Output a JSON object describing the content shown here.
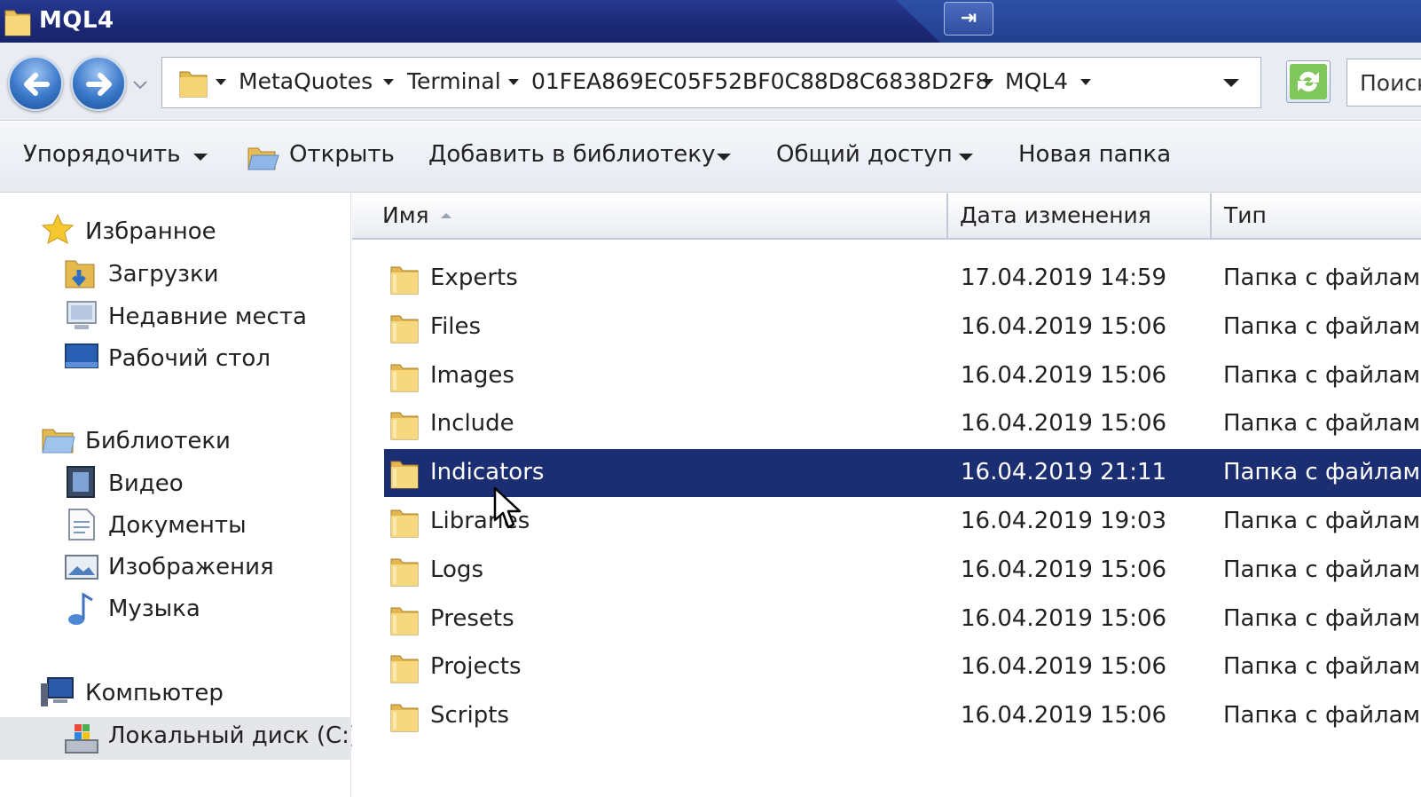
{
  "window": {
    "title": "MQL4"
  },
  "address": {
    "crumbs": [
      "MetaQuotes",
      "Terminal",
      "01FEA869EC05F52BF0C88D8C6838D2F8",
      "MQL4"
    ],
    "search_placeholder": "Поиск"
  },
  "toolbar": {
    "organize": "Упорядочить",
    "open": "Открыть",
    "add_library": "Добавить в библиотеку",
    "share": "Общий доступ",
    "new_folder": "Новая папка"
  },
  "nav": {
    "favorites": "Избранное",
    "downloads": "Загрузки",
    "recent": "Недавние места",
    "desktop": "Рабочий стол",
    "libraries": "Библиотеки",
    "video": "Видео",
    "documents": "Документы",
    "images": "Изображения",
    "music": "Музыка",
    "computer": "Компьютер",
    "local_disk": "Локальный диск (C:)"
  },
  "columns": {
    "name": "Имя",
    "date": "Дата изменения",
    "type": "Тип"
  },
  "files": [
    {
      "name": "Experts",
      "date": "17.04.2019 14:59",
      "type": "Папка с файлами"
    },
    {
      "name": "Files",
      "date": "16.04.2019 15:06",
      "type": "Папка с файлами"
    },
    {
      "name": "Images",
      "date": "16.04.2019 15:06",
      "type": "Папка с файлами"
    },
    {
      "name": "Include",
      "date": "16.04.2019 15:06",
      "type": "Папка с файлами"
    },
    {
      "name": "Indicators",
      "date": "16.04.2019 21:11",
      "type": "Папка с файлами",
      "selected": true
    },
    {
      "name": "Libraries",
      "date": "16.04.2019 19:03",
      "type": "Папка с файлами"
    },
    {
      "name": "Logs",
      "date": "16.04.2019 15:06",
      "type": "Папка с файлами"
    },
    {
      "name": "Presets",
      "date": "16.04.2019 15:06",
      "type": "Папка с файлами"
    },
    {
      "name": "Projects",
      "date": "16.04.2019 15:06",
      "type": "Папка с файлами"
    },
    {
      "name": "Scripts",
      "date": "16.04.2019 15:06",
      "type": "Папка с файлами"
    }
  ],
  "colors": {
    "selection": "#1c2e72",
    "titlebar": "#1c2a78"
  }
}
